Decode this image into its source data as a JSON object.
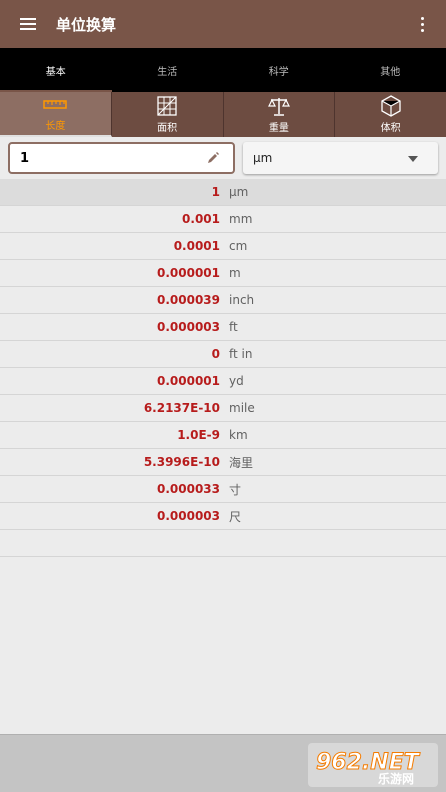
{
  "appbar": {
    "title": "单位换算",
    "menu_icon": "hamburger-menu-icon",
    "overflow_icon": "more-vert-icon",
    "color": "#795548"
  },
  "top_tabs": [
    {
      "label": "基本",
      "active": true
    },
    {
      "label": "生活",
      "active": false
    },
    {
      "label": "科学",
      "active": false
    },
    {
      "label": "其他",
      "active": false
    }
  ],
  "sub_tabs": [
    {
      "label": "长度",
      "icon": "ruler-icon",
      "active": true
    },
    {
      "label": "面积",
      "icon": "area-grid-icon",
      "active": false
    },
    {
      "label": "重量",
      "icon": "scale-icon",
      "active": false
    },
    {
      "label": "体积",
      "icon": "cube-icon",
      "active": false
    }
  ],
  "input": {
    "value": "1",
    "edit_icon": "pencil-icon"
  },
  "unit_select": {
    "selected": "μm",
    "icon": "dropdown-arrow-icon"
  },
  "results": [
    {
      "value": "1",
      "unit": "μm"
    },
    {
      "value": "0.001",
      "unit": "mm"
    },
    {
      "value": "0.0001",
      "unit": "cm"
    },
    {
      "value": "0.000001",
      "unit": "m"
    },
    {
      "value": "0.000039",
      "unit": "inch"
    },
    {
      "value": "0.000003",
      "unit": "ft"
    },
    {
      "value": "0",
      "unit": "ft in"
    },
    {
      "value": "0.000001",
      "unit": "yd"
    },
    {
      "value": "6.2137E-10",
      "unit": "mile"
    },
    {
      "value": "1.0E-9",
      "unit": "km"
    },
    {
      "value": "5.3996E-10",
      "unit": "海里"
    },
    {
      "value": "0.000033",
      "unit": "寸"
    },
    {
      "value": "0.000003",
      "unit": "尺"
    }
  ],
  "watermark": {
    "brand": "962.NET",
    "subtitle": "乐游网"
  }
}
